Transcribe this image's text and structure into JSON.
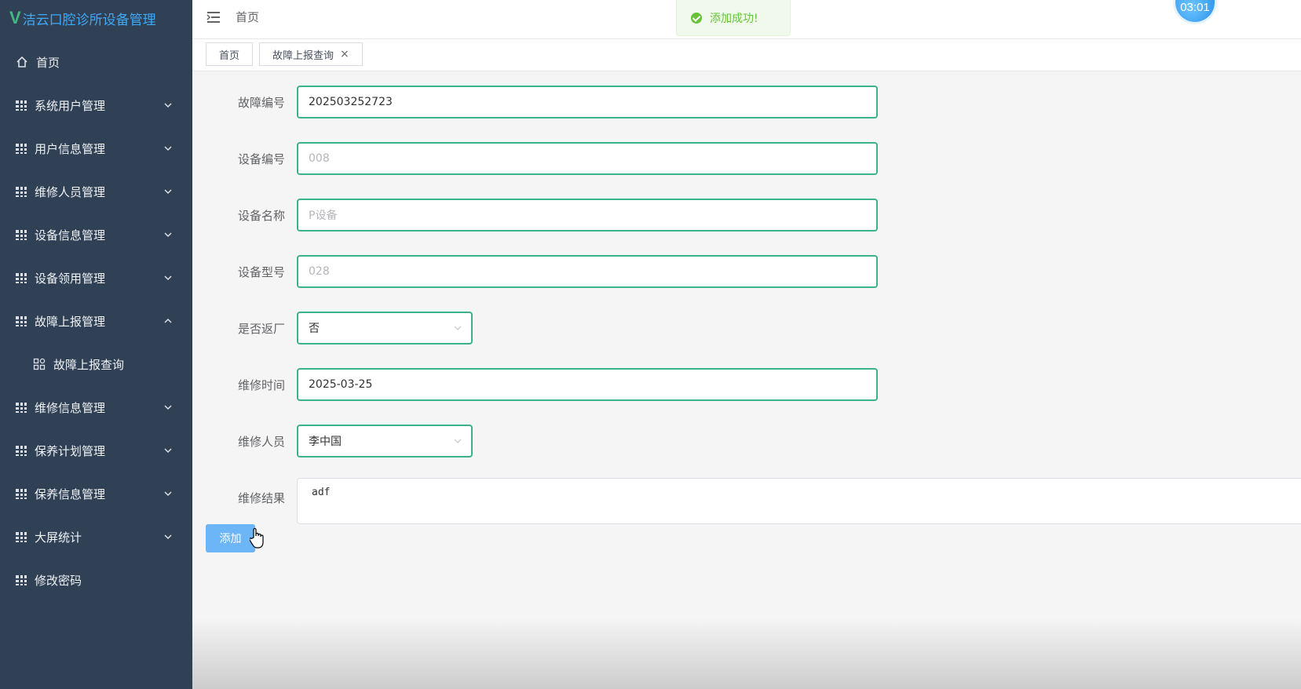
{
  "app": {
    "logo_mark": "V",
    "title": "洁云口腔诊所设备管理"
  },
  "sidebar": {
    "items": [
      {
        "label": "首页",
        "icon": "home-icon"
      },
      {
        "label": "系统用户管理",
        "icon": "grid-icon",
        "expanded": false
      },
      {
        "label": "用户信息管理",
        "icon": "grid-icon",
        "expanded": false
      },
      {
        "label": "维修人员管理",
        "icon": "grid-icon",
        "expanded": false
      },
      {
        "label": "设备信息管理",
        "icon": "grid-icon",
        "expanded": false
      },
      {
        "label": "设备领用管理",
        "icon": "grid-icon",
        "expanded": false
      },
      {
        "label": "故障上报管理",
        "icon": "grid-icon",
        "expanded": true
      },
      {
        "label": "故障上报查询",
        "icon": "apps-icon",
        "sub": true
      },
      {
        "label": "维修信息管理",
        "icon": "grid-icon",
        "expanded": false
      },
      {
        "label": "保养计划管理",
        "icon": "grid-icon",
        "expanded": false
      },
      {
        "label": "保养信息管理",
        "icon": "grid-icon",
        "expanded": false
      },
      {
        "label": "大屏统计",
        "icon": "grid-icon",
        "expanded": false
      },
      {
        "label": "修改密码",
        "icon": "grid-icon"
      }
    ]
  },
  "header": {
    "breadcrumb": "首页",
    "toast": "添加成功!",
    "avatar_time": "03:01"
  },
  "tags": [
    {
      "label": "首页"
    },
    {
      "label": "故障上报查询",
      "closable": true,
      "close_glyph": "×"
    }
  ],
  "form": {
    "fault_no": {
      "label": "故障编号",
      "value": "202503252723"
    },
    "device_no": {
      "label": "设备编号",
      "placeholder": "008"
    },
    "device_name": {
      "label": "设备名称",
      "placeholder": "P设备"
    },
    "device_model": {
      "label": "设备型号",
      "placeholder": "028"
    },
    "return_factory": {
      "label": "是否返厂",
      "value": "否"
    },
    "repair_time": {
      "label": "维修时间",
      "value": "2025-03-25"
    },
    "repairer": {
      "label": "维修人员",
      "value": "李中国"
    },
    "repair_result": {
      "label": "维修结果",
      "value": "adf"
    },
    "submit_label": "添加"
  },
  "colors": {
    "sidebar_bg": "#304156",
    "accent_green": "#3bb28a",
    "success": "#67c23a",
    "primary_light": "#6cb5f7"
  }
}
